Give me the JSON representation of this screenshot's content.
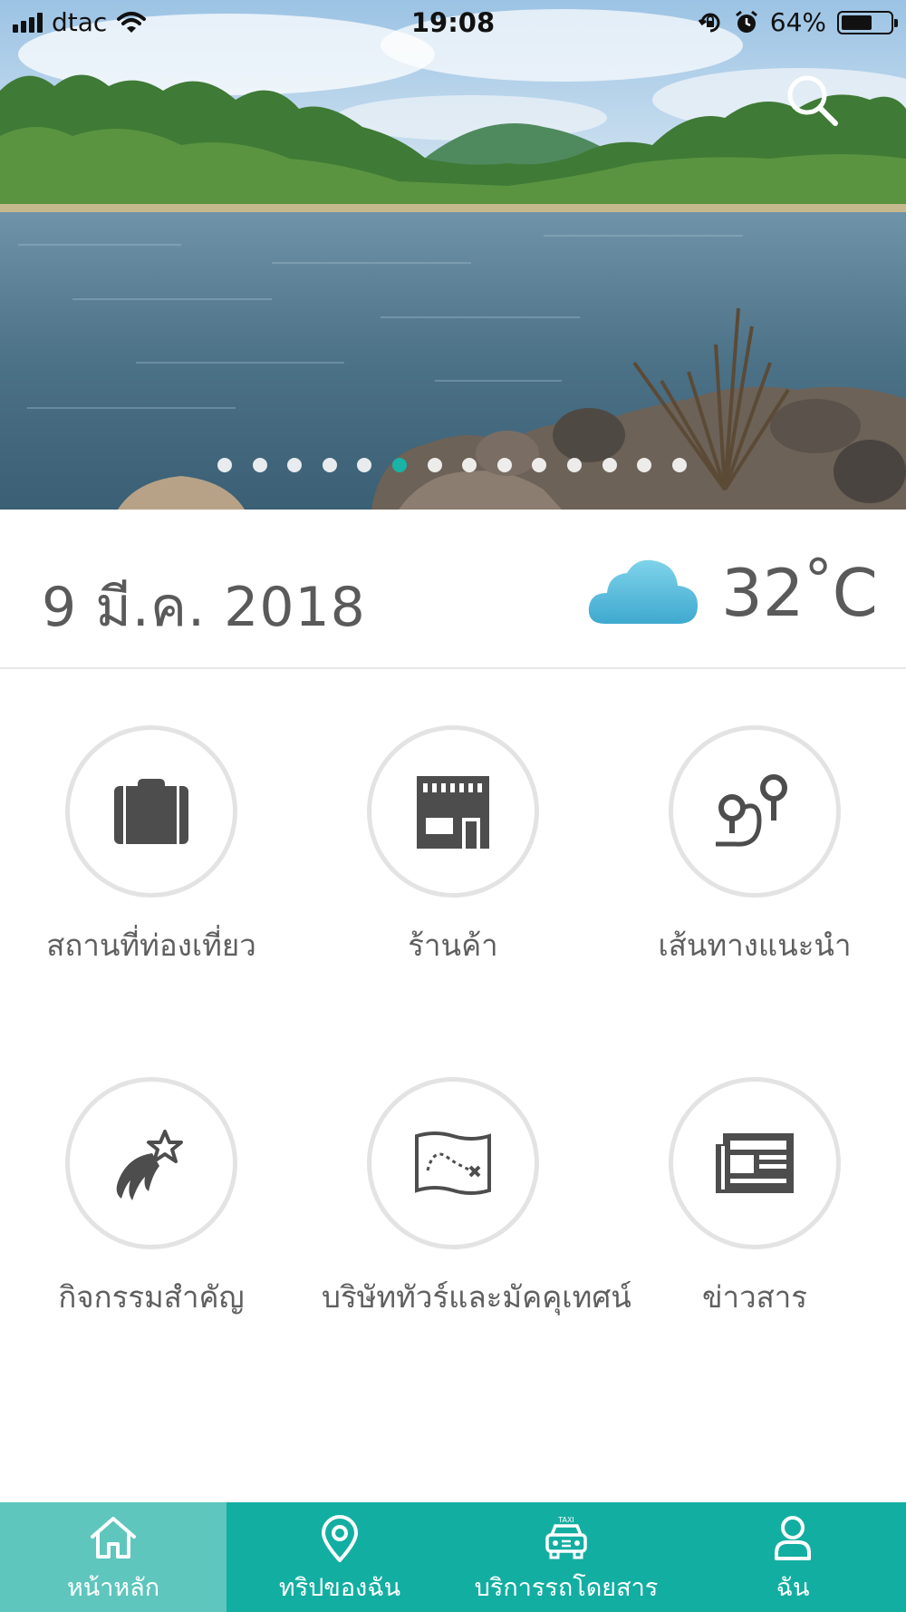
{
  "status_bar": {
    "carrier": "dtac",
    "time": "19:08",
    "battery_percent": "64%",
    "battery_level": 0.64,
    "icons": [
      "signal-icon",
      "wifi-icon",
      "rotation-lock-icon",
      "alarm-icon",
      "battery-icon"
    ]
  },
  "hero": {
    "search_icon": "search-icon",
    "carousel_total": 14,
    "carousel_active_index": 5
  },
  "info": {
    "date": "9 มี.ค. 2018",
    "weather_icon": "cloud-icon",
    "temperature": "32",
    "temperature_unit": "C",
    "degree_symbol": "°"
  },
  "menu": [
    {
      "label": "สถานที่ท่องเที่ยว",
      "icon": "suitcase-icon"
    },
    {
      "label": "ร้านค้า",
      "icon": "shop-icon"
    },
    {
      "label": "เส้นทางแนะนำ",
      "icon": "route-icon"
    },
    {
      "label": "กิจกรรมสำคัญ",
      "icon": "shooting-star-icon"
    },
    {
      "label": "บริษัททัวร์และมัคคุเทศน์",
      "icon": "treasure-map-icon"
    },
    {
      "label": "ข่าวสาร",
      "icon": "newspaper-icon"
    }
  ],
  "tabs": [
    {
      "label": "หน้าหลัก",
      "icon": "home-icon",
      "active": true
    },
    {
      "label": "ทริปของฉัน",
      "icon": "location-pin-icon",
      "active": false
    },
    {
      "label": "บริการรถโดยสาร",
      "icon": "taxi-icon",
      "taxi_sign": "TAXI",
      "active": false
    },
    {
      "label": "ฉัน",
      "icon": "user-icon",
      "active": false
    }
  ],
  "colors": {
    "accent": "#13aea2",
    "accent_active_tab": "#5ec6bd",
    "icon_gray": "#4d4d4d",
    "circle_border": "#e3e3e3",
    "cloud": "#5bbfdb"
  }
}
